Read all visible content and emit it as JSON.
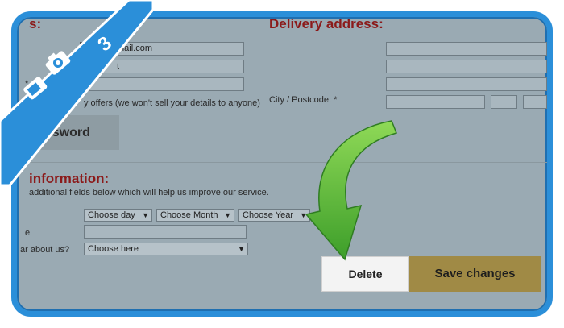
{
  "left_section": {
    "title_fragment": "s:",
    "email_value": "mail.com",
    "name_value": "t",
    "required_mark": "*",
    "offers_text": "y offers (we won't sell your details to anyone)"
  },
  "password_button_label": "assword",
  "delivery": {
    "title": "Delivery address:",
    "city_label": "City / Postcode: *"
  },
  "info": {
    "title": "information:",
    "description": "additional fields below which will help us improve our service.",
    "birth_label": "e",
    "about_label": "ar about us?",
    "day_select": "Choose day",
    "month_select": "Choose Month",
    "year_select": "Choose Year",
    "about_select": "Choose here"
  },
  "actions": {
    "delete_label": "Delete",
    "save_label": "Save changes"
  },
  "badge": {
    "step_number": "3",
    "icon_names": [
      "camera-icon",
      "mobile-phone-icon"
    ],
    "color": "#2b8fd9"
  },
  "arrow_color": "#5cbf3a",
  "accent_color": "#8b1a1a"
}
